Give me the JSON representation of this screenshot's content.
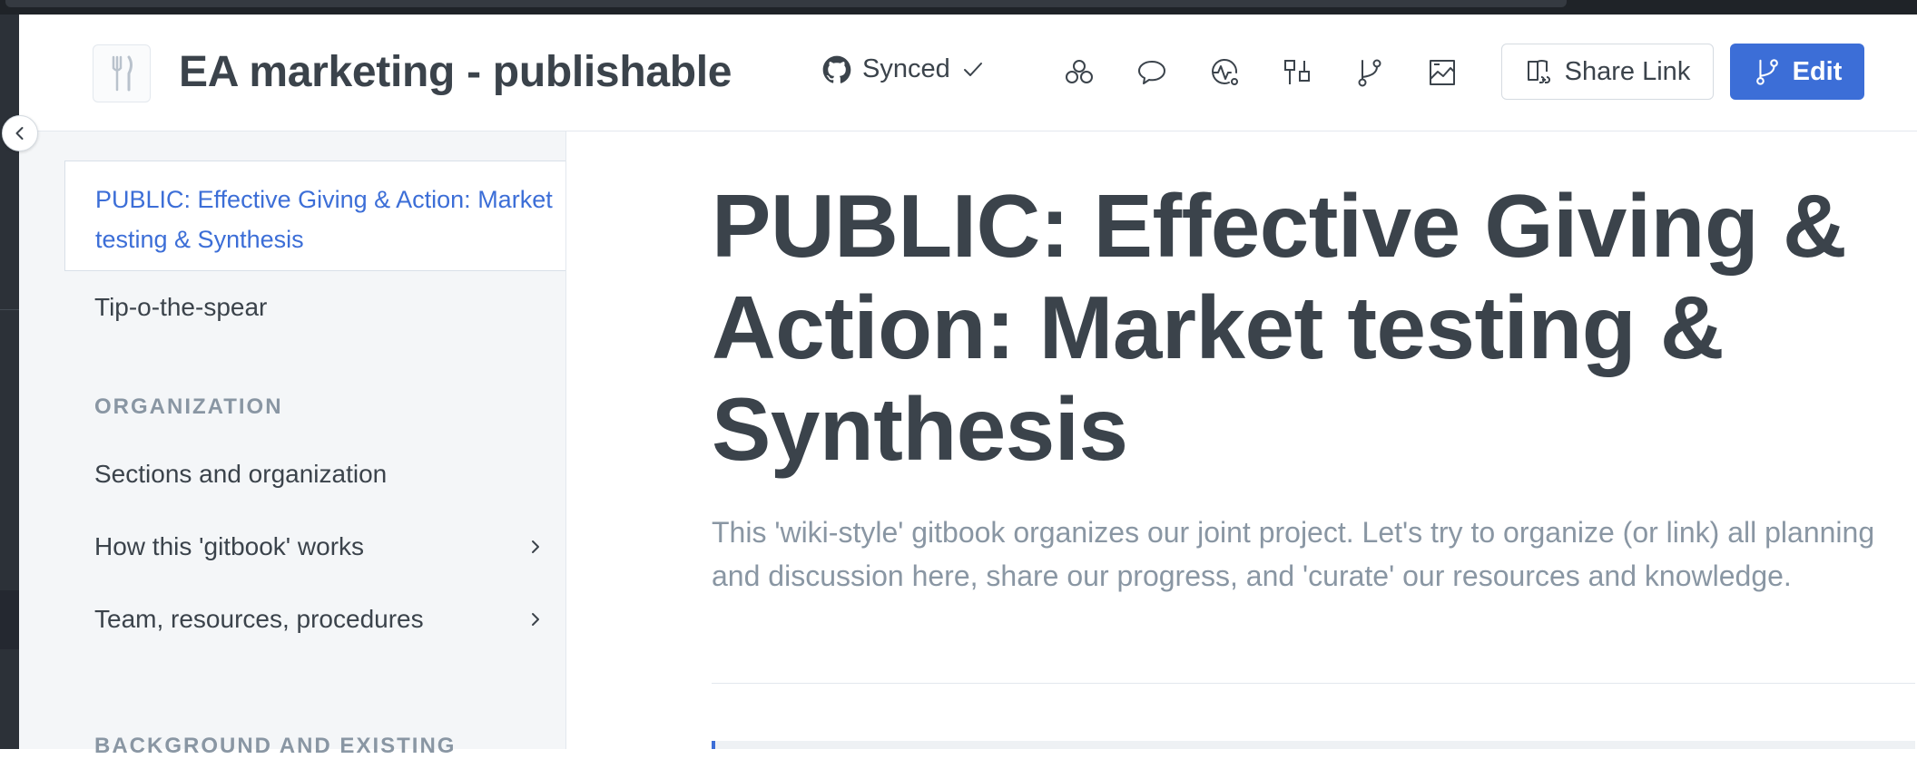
{
  "header": {
    "title": "EA marketing - publishable",
    "sync_label": "Synced",
    "share_label": "Share Link",
    "edit_label": "Edit",
    "toolbar_icons": [
      "contributors-icon",
      "comments-icon",
      "activity-icon",
      "merge-requests-icon",
      "branch-icon",
      "insights-icon"
    ]
  },
  "sidebar": {
    "active_item": "PUBLIC: Effective Giving & Action: Market testing & Synthesis",
    "items": [
      {
        "label": "Tip-o-the-spear"
      }
    ],
    "sections": [
      {
        "title": "ORGANIZATION",
        "items": [
          {
            "label": "Sections and organization",
            "expandable": false
          },
          {
            "label": "How this 'gitbook' works",
            "expandable": true
          },
          {
            "label": "Team, resources, procedures",
            "expandable": true
          }
        ]
      },
      {
        "title": "BACKGROUND AND EXISTING"
      }
    ]
  },
  "page": {
    "title": "PUBLIC: Effective Giving & Action: Market testing & Synthesis",
    "description": "This 'wiki-style' gitbook organizes our joint project. Let's try to organize (or link) all planning and discussion here, share our progress, and 'curate' our resources and knowledge."
  },
  "colors": {
    "accent": "#3c6ed7",
    "text": "#3b434b",
    "muted": "#8996a3",
    "sidebar_bg": "#f4f6f8"
  }
}
